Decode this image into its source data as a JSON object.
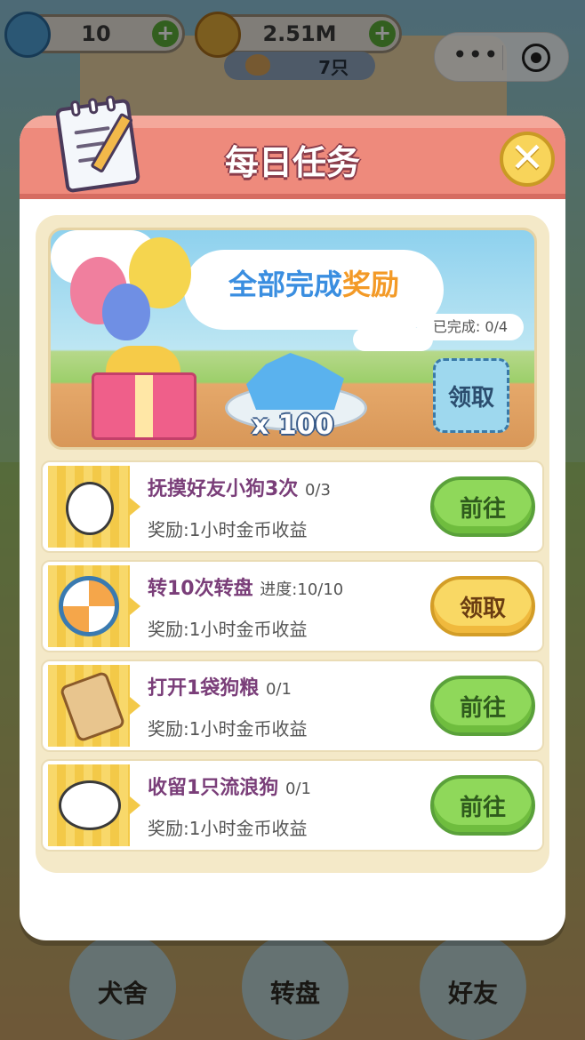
{
  "top_bar": {
    "gems": "10",
    "coins": "2.51M",
    "dog_count": "7只"
  },
  "bottom_nav": {
    "kennel": "犬舍",
    "wheel": "转盘",
    "friends": "好友"
  },
  "modal": {
    "title": "每日任务",
    "close_icon": "close-icon"
  },
  "banner": {
    "title_main": "全部完成",
    "title_highlight": "奖励",
    "progress": "已完成: 0/4",
    "reward_qty": "x 100",
    "claim_label": "领取"
  },
  "tasks": [
    {
      "title": "抚摸好友小狗3次",
      "progress": "0/3",
      "reward": "奖励:1小时金币收益",
      "button": "前往",
      "button_state": "go"
    },
    {
      "title": "转10次转盘",
      "progress": "进度:10/10",
      "reward": "奖励:1小时金币收益",
      "button": "领取",
      "button_state": "claim"
    },
    {
      "title": "打开1袋狗粮",
      "progress": "0/1",
      "reward": "奖励:1小时金币收益",
      "button": "前往",
      "button_state": "go"
    },
    {
      "title": "收留1只流浪狗",
      "progress": "0/1",
      "reward": "奖励:1小时金币收益",
      "button": "前往",
      "button_state": "go"
    }
  ],
  "colors": {
    "header": "#ee8a7c",
    "go_button": "#8fd85a",
    "claim_button": "#f9d864",
    "task_title": "#7a3e79"
  }
}
